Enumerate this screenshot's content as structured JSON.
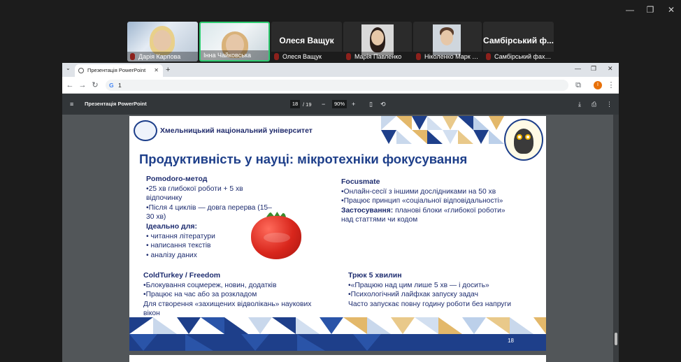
{
  "os": {
    "minimize": "—",
    "restore": "❐",
    "close": "✕"
  },
  "participants": [
    {
      "name": "Дарія Карпова",
      "muted": true
    },
    {
      "name": "Інна Чайковська",
      "muted": false,
      "active": true
    },
    {
      "name": "Олеся Ващук",
      "muted": true,
      "display": "Олеся Ващук"
    },
    {
      "name": "Марія Павленко",
      "muted": true
    },
    {
      "name": "Ніколенко Марк СФ Х...",
      "muted": true
    },
    {
      "name": "Самбірський фаховий...",
      "muted": true,
      "display": "Самбірський ф..."
    }
  ],
  "browser": {
    "tab_title": "Презентація PowerPoint",
    "new_tab": "+",
    "win_controls": {
      "minimize": "—",
      "restore": "❐",
      "close": "✕"
    },
    "url": "1",
    "avatar_letter": "I"
  },
  "pdf": {
    "title": "Презентація PowerPoint",
    "page_current": "18",
    "page_total": "/ 19",
    "zoom": "90%"
  },
  "slide": {
    "university": "Хмельницький національний університет",
    "title": "Продуктивність у науці: мікротехніки фокусування",
    "pomodoro": {
      "heading": "Pomodoro-метод",
      "l1": "•25 хв глибокої роботи + 5 хв",
      "l2": "відпочинку",
      "l3": "•Після 4 циклів — довга перерва (15–",
      "l4": "30 хв)",
      "ideal": "Ідеально для:",
      "b1": "• читання літератури",
      "b2": "• написання текстів",
      "b3": "• аналізу даних"
    },
    "focusmate": {
      "heading": "Focusmate",
      "l1": "•Онлайн-сесії з іншими дослідниками на 50 хв",
      "l2": "•Працює принцип «соціальної відповідальності»",
      "apply_label": "Застосування:",
      "l3": " планові блоки «глибокої роботи»",
      "l4": "над статтями чи кодом"
    },
    "coldturkey": {
      "heading": "ColdTurkey / Freedom",
      "l1": "•Блокування соцмереж, новин, додатків",
      "l2": "•Працює на час або за розкладом",
      "l3": "Для створення «захищених відволікань» наукових",
      "l4": "вікон"
    },
    "trick": {
      "heading": "Трюк 5 хвилин",
      "l1": "•«Працюю над цим лише 5 хв — і досить»",
      "l2": "•Психологічний лайфхак запуску задач",
      "l3": "Часто запускає повну годину роботи без напруги"
    },
    "page_number": "18"
  }
}
